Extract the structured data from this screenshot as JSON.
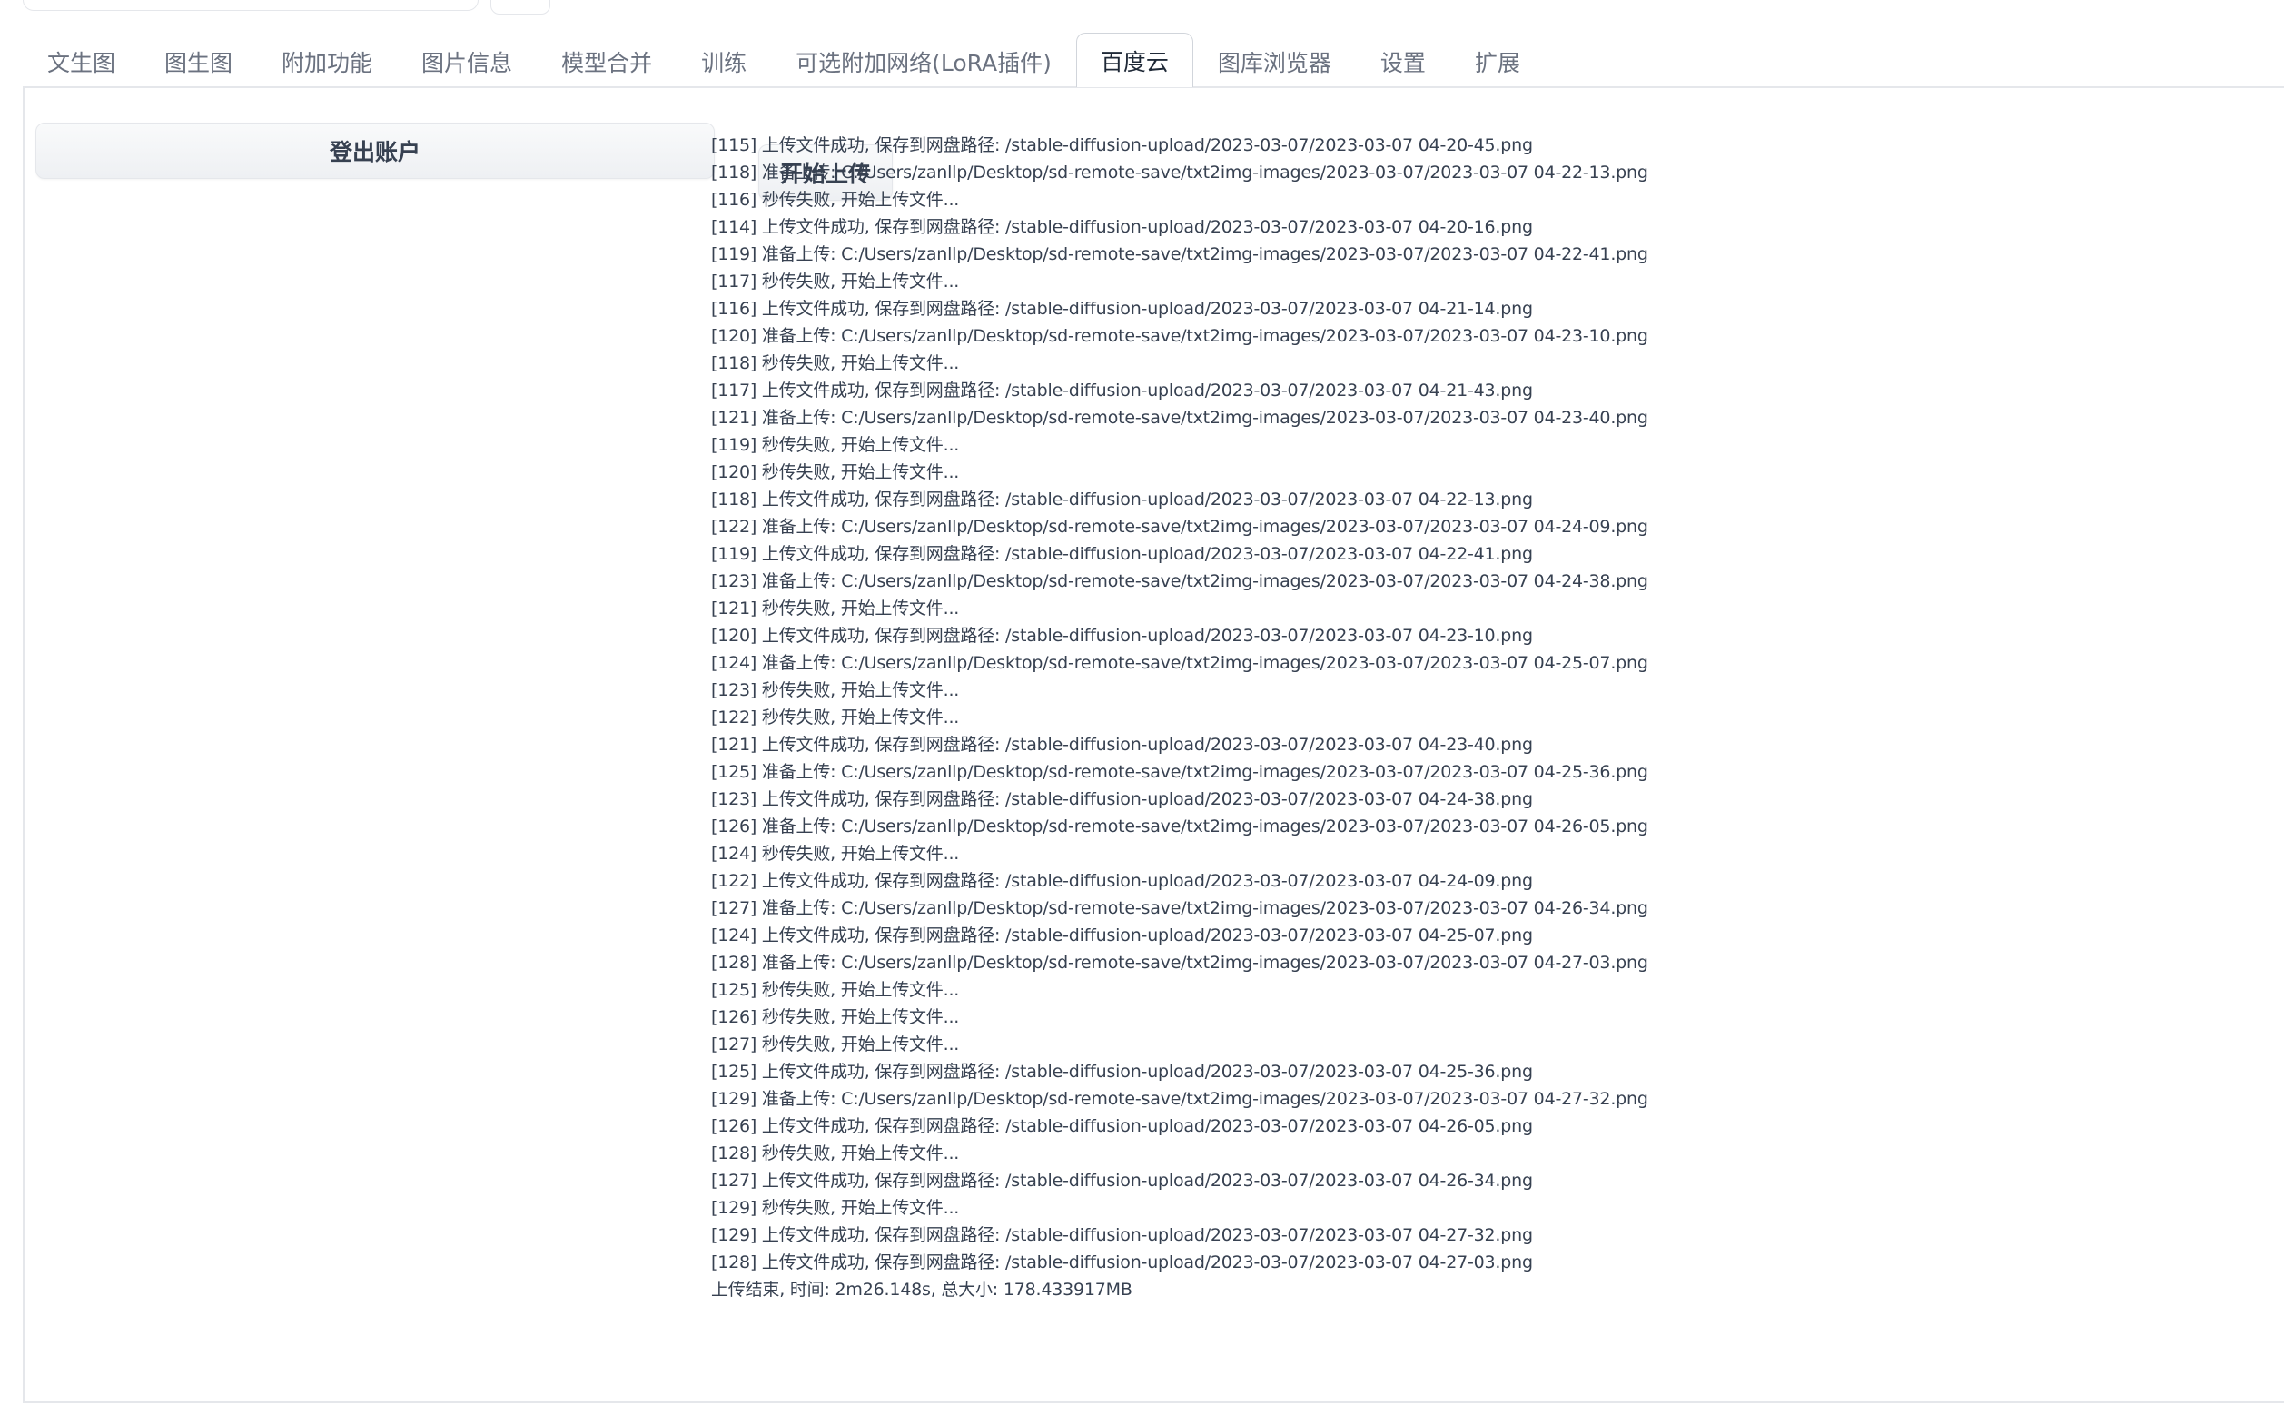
{
  "tabs": [
    {
      "label": "文生图",
      "active": false
    },
    {
      "label": "图生图",
      "active": false
    },
    {
      "label": "附加功能",
      "active": false
    },
    {
      "label": "图片信息",
      "active": false
    },
    {
      "label": "模型合并",
      "active": false
    },
    {
      "label": "训练",
      "active": false
    },
    {
      "label": "可选附加网络(LoRA插件)",
      "active": false
    },
    {
      "label": "百度云",
      "active": true
    },
    {
      "label": "图库浏览器",
      "active": false
    },
    {
      "label": "设置",
      "active": false
    },
    {
      "label": "扩展",
      "active": false
    }
  ],
  "buttons": {
    "logout": "登出账户",
    "start_upload": "开始上传"
  },
  "colors": {
    "active_tab_border": "#d1d5db",
    "button_bg": "#f3f4f6",
    "text": "#374151",
    "inactive_tab_text": "#6b7280"
  },
  "log_lines": [
    "[115] 上传文件成功, 保存到网盘路径: /stable-diffusion-upload/2023-03-07/2023-03-07 04-20-45.png",
    "[118] 准备上传: C:/Users/zanllp/Desktop/sd-remote-save/txt2img-images/2023-03-07/2023-03-07 04-22-13.png",
    "[116] 秒传失败, 开始上传文件...",
    "[114] 上传文件成功, 保存到网盘路径: /stable-diffusion-upload/2023-03-07/2023-03-07 04-20-16.png",
    "[119] 准备上传: C:/Users/zanllp/Desktop/sd-remote-save/txt2img-images/2023-03-07/2023-03-07 04-22-41.png",
    "[117] 秒传失败, 开始上传文件...",
    "[116] 上传文件成功, 保存到网盘路径: /stable-diffusion-upload/2023-03-07/2023-03-07 04-21-14.png",
    "[120] 准备上传: C:/Users/zanllp/Desktop/sd-remote-save/txt2img-images/2023-03-07/2023-03-07 04-23-10.png",
    "[118] 秒传失败, 开始上传文件...",
    "[117] 上传文件成功, 保存到网盘路径: /stable-diffusion-upload/2023-03-07/2023-03-07 04-21-43.png",
    "[121] 准备上传: C:/Users/zanllp/Desktop/sd-remote-save/txt2img-images/2023-03-07/2023-03-07 04-23-40.png",
    "[119] 秒传失败, 开始上传文件...",
    "[120] 秒传失败, 开始上传文件...",
    "[118] 上传文件成功, 保存到网盘路径: /stable-diffusion-upload/2023-03-07/2023-03-07 04-22-13.png",
    "[122] 准备上传: C:/Users/zanllp/Desktop/sd-remote-save/txt2img-images/2023-03-07/2023-03-07 04-24-09.png",
    "[119] 上传文件成功, 保存到网盘路径: /stable-diffusion-upload/2023-03-07/2023-03-07 04-22-41.png",
    "[123] 准备上传: C:/Users/zanllp/Desktop/sd-remote-save/txt2img-images/2023-03-07/2023-03-07 04-24-38.png",
    "[121] 秒传失败, 开始上传文件...",
    "[120] 上传文件成功, 保存到网盘路径: /stable-diffusion-upload/2023-03-07/2023-03-07 04-23-10.png",
    "[124] 准备上传: C:/Users/zanllp/Desktop/sd-remote-save/txt2img-images/2023-03-07/2023-03-07 04-25-07.png",
    "[123] 秒传失败, 开始上传文件...",
    "[122] 秒传失败, 开始上传文件...",
    "[121] 上传文件成功, 保存到网盘路径: /stable-diffusion-upload/2023-03-07/2023-03-07 04-23-40.png",
    "[125] 准备上传: C:/Users/zanllp/Desktop/sd-remote-save/txt2img-images/2023-03-07/2023-03-07 04-25-36.png",
    "[123] 上传文件成功, 保存到网盘路径: /stable-diffusion-upload/2023-03-07/2023-03-07 04-24-38.png",
    "[126] 准备上传: C:/Users/zanllp/Desktop/sd-remote-save/txt2img-images/2023-03-07/2023-03-07 04-26-05.png",
    "[124] 秒传失败, 开始上传文件...",
    "[122] 上传文件成功, 保存到网盘路径: /stable-diffusion-upload/2023-03-07/2023-03-07 04-24-09.png",
    "[127] 准备上传: C:/Users/zanllp/Desktop/sd-remote-save/txt2img-images/2023-03-07/2023-03-07 04-26-34.png",
    "[124] 上传文件成功, 保存到网盘路径: /stable-diffusion-upload/2023-03-07/2023-03-07 04-25-07.png",
    "[128] 准备上传: C:/Users/zanllp/Desktop/sd-remote-save/txt2img-images/2023-03-07/2023-03-07 04-27-03.png",
    "[125] 秒传失败, 开始上传文件...",
    "[126] 秒传失败, 开始上传文件...",
    "[127] 秒传失败, 开始上传文件...",
    "[125] 上传文件成功, 保存到网盘路径: /stable-diffusion-upload/2023-03-07/2023-03-07 04-25-36.png",
    "[129] 准备上传: C:/Users/zanllp/Desktop/sd-remote-save/txt2img-images/2023-03-07/2023-03-07 04-27-32.png",
    "[126] 上传文件成功, 保存到网盘路径: /stable-diffusion-upload/2023-03-07/2023-03-07 04-26-05.png",
    "[128] 秒传失败, 开始上传文件...",
    "[127] 上传文件成功, 保存到网盘路径: /stable-diffusion-upload/2023-03-07/2023-03-07 04-26-34.png",
    "[129] 秒传失败, 开始上传文件...",
    "[129] 上传文件成功, 保存到网盘路径: /stable-diffusion-upload/2023-03-07/2023-03-07 04-27-32.png",
    "[128] 上传文件成功, 保存到网盘路径: /stable-diffusion-upload/2023-03-07/2023-03-07 04-27-03.png",
    "上传结束, 时间: 2m26.148s, 总大小: 178.433917MB"
  ]
}
